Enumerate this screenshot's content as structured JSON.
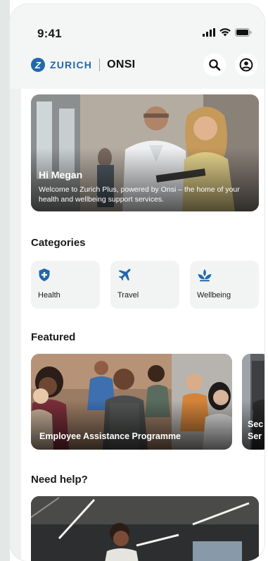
{
  "status": {
    "time": "9:41"
  },
  "brand": {
    "partner": "ZURICH",
    "app": "ONSI",
    "logo_letter": "Z"
  },
  "header": {
    "icons": [
      "search-icon",
      "profile-icon"
    ]
  },
  "hero": {
    "greeting": "Hi Megan",
    "description": "Welcome to Zurich Plus, powered by Onsi – the home of your health and wellbeing support services."
  },
  "categories": {
    "title": "Categories",
    "items": [
      {
        "label": "Health",
        "icon": "shield-plus-icon"
      },
      {
        "label": "Travel",
        "icon": "plane-icon"
      },
      {
        "label": "Wellbeing",
        "icon": "lotus-icon"
      }
    ]
  },
  "featured": {
    "title": "Featured",
    "items": [
      {
        "label": "Employee Assistance Programme"
      },
      {
        "label": "Sec Ser"
      }
    ]
  },
  "help": {
    "title": "Need help?"
  },
  "colors": {
    "brand_blue": "#2167ae",
    "text": "#1a1a1a",
    "card_bg": "#f2f4f4"
  }
}
